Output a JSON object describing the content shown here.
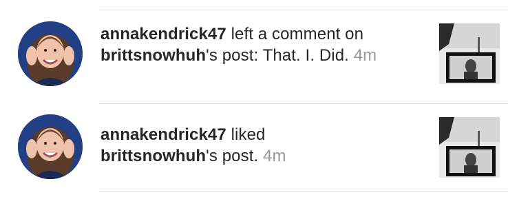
{
  "notifications": [
    {
      "username": "annakendrick47",
      "action": " left a comment on ",
      "target_user": "brittsnowhuh",
      "target_suffix": "'s post: That. I. Did.",
      "time": "4m"
    },
    {
      "username": "annakendrick47",
      "action": " liked ",
      "target_user": "brittsnowhuh",
      "target_suffix": "'s post.",
      "time": "4m"
    }
  ],
  "colors": {
    "text": "#262626",
    "muted": "#999999",
    "divider": "#dbdbdb"
  }
}
